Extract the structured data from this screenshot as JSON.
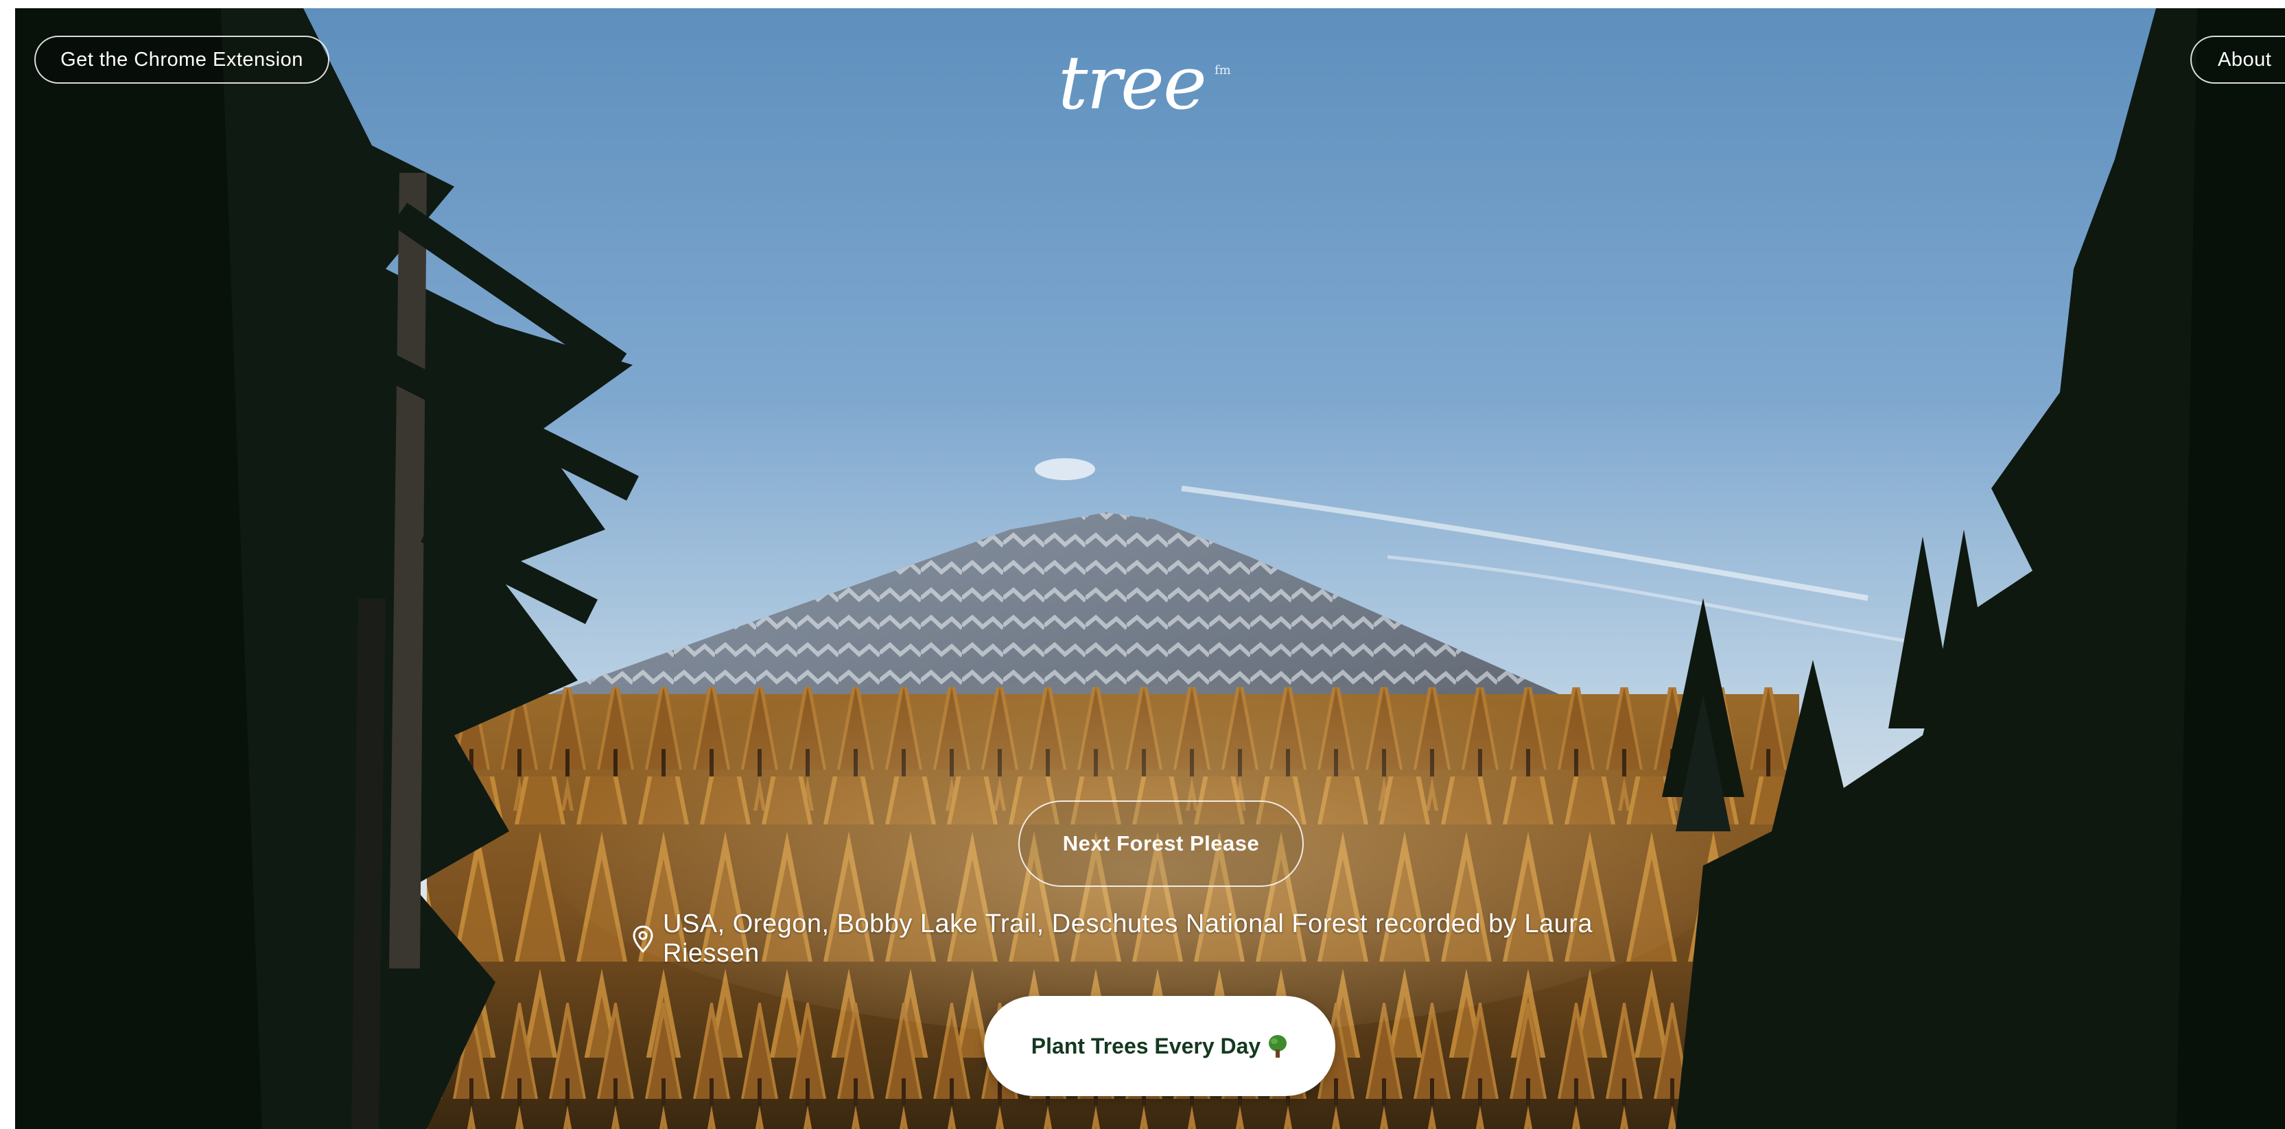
{
  "header": {
    "extension_label": "Get the Chrome Extension",
    "logo_text": "tree",
    "logo_superscript": "fm",
    "about_label": "About"
  },
  "main": {
    "next_forest_label": "Next Forest Please",
    "location_icon": "map-pin-icon",
    "location_text": "USA, Oregon, Bobby Lake Trail, Deschutes National Forest recorded by Laura Riessen",
    "plant_trees_label": "Plant Trees Every Day",
    "plant_trees_icon": "tree-icon"
  },
  "colors": {
    "sky": "#6f9fc9",
    "forest_gold": "#b57a2e",
    "dark_tree": "#0f1a12",
    "button_text": "#143820",
    "tree_icon_green": "#3e8b2f"
  }
}
